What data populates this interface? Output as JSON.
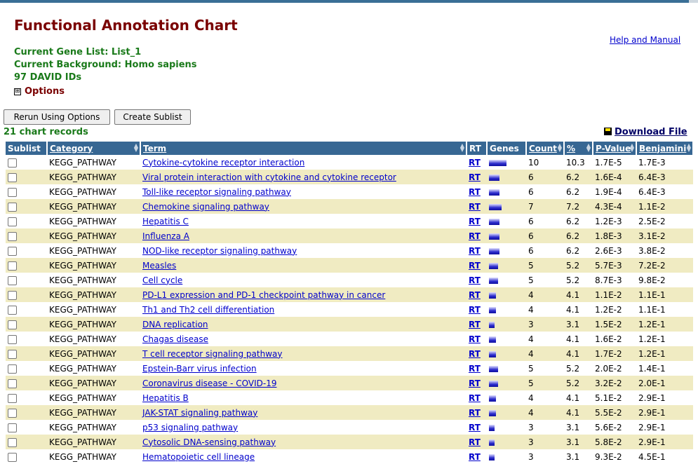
{
  "header": {
    "title": "Functional Annotation Chart",
    "help_link": "Help and Manual",
    "gene_list": "Current Gene List: List_1",
    "background": "Current Background: Homo sapiens",
    "id_count": "97 DAVID IDs",
    "options_toggle": "⊞",
    "options_label": "Options"
  },
  "toolbar": {
    "rerun_label": "Rerun Using Options",
    "sublist_label": "Create Sublist",
    "records_label": "21 chart records",
    "download_label": "Download File"
  },
  "table": {
    "columns": [
      "Sublist",
      "Category",
      "Term",
      "RT",
      "Genes",
      "Count",
      "%",
      "P-Value",
      "Benjamini"
    ],
    "rows": [
      {
        "category": "KEGG_PATHWAY",
        "term": "Cytokine-cytokine receptor interaction",
        "rt": "RT",
        "count": "10",
        "percent": "10.3",
        "pvalue": "1.7E-5",
        "benjamini": "1.7E-3"
      },
      {
        "category": "KEGG_PATHWAY",
        "term": "Viral protein interaction with cytokine and cytokine receptor",
        "rt": "RT",
        "count": "6",
        "percent": "6.2",
        "pvalue": "1.6E-4",
        "benjamini": "6.4E-3"
      },
      {
        "category": "KEGG_PATHWAY",
        "term": "Toll-like receptor signaling pathway",
        "rt": "RT",
        "count": "6",
        "percent": "6.2",
        "pvalue": "1.9E-4",
        "benjamini": "6.4E-3"
      },
      {
        "category": "KEGG_PATHWAY",
        "term": "Chemokine signaling pathway",
        "rt": "RT",
        "count": "7",
        "percent": "7.2",
        "pvalue": "4.3E-4",
        "benjamini": "1.1E-2"
      },
      {
        "category": "KEGG_PATHWAY",
        "term": "Hepatitis C",
        "rt": "RT",
        "count": "6",
        "percent": "6.2",
        "pvalue": "1.2E-3",
        "benjamini": "2.5E-2"
      },
      {
        "category": "KEGG_PATHWAY",
        "term": "Influenza A",
        "rt": "RT",
        "count": "6",
        "percent": "6.2",
        "pvalue": "1.8E-3",
        "benjamini": "3.1E-2"
      },
      {
        "category": "KEGG_PATHWAY",
        "term": "NOD-like receptor signaling pathway",
        "rt": "RT",
        "count": "6",
        "percent": "6.2",
        "pvalue": "2.6E-3",
        "benjamini": "3.8E-2"
      },
      {
        "category": "KEGG_PATHWAY",
        "term": "Measles",
        "rt": "RT",
        "count": "5",
        "percent": "5.2",
        "pvalue": "5.7E-3",
        "benjamini": "7.2E-2"
      },
      {
        "category": "KEGG_PATHWAY",
        "term": "Cell cycle",
        "rt": "RT",
        "count": "5",
        "percent": "5.2",
        "pvalue": "8.7E-3",
        "benjamini": "9.8E-2"
      },
      {
        "category": "KEGG_PATHWAY",
        "term": "PD-L1 expression and PD-1 checkpoint pathway in cancer",
        "rt": "RT",
        "count": "4",
        "percent": "4.1",
        "pvalue": "1.1E-2",
        "benjamini": "1.1E-1"
      },
      {
        "category": "KEGG_PATHWAY",
        "term": "Th1 and Th2 cell differentiation",
        "rt": "RT",
        "count": "4",
        "percent": "4.1",
        "pvalue": "1.2E-2",
        "benjamini": "1.1E-1"
      },
      {
        "category": "KEGG_PATHWAY",
        "term": "DNA replication",
        "rt": "RT",
        "count": "3",
        "percent": "3.1",
        "pvalue": "1.5E-2",
        "benjamini": "1.2E-1"
      },
      {
        "category": "KEGG_PATHWAY",
        "term": "Chagas disease",
        "rt": "RT",
        "count": "4",
        "percent": "4.1",
        "pvalue": "1.6E-2",
        "benjamini": "1.2E-1"
      },
      {
        "category": "KEGG_PATHWAY",
        "term": "T cell receptor signaling pathway",
        "rt": "RT",
        "count": "4",
        "percent": "4.1",
        "pvalue": "1.7E-2",
        "benjamini": "1.2E-1"
      },
      {
        "category": "KEGG_PATHWAY",
        "term": "Epstein-Barr virus infection",
        "rt": "RT",
        "count": "5",
        "percent": "5.2",
        "pvalue": "2.0E-2",
        "benjamini": "1.4E-1"
      },
      {
        "category": "KEGG_PATHWAY",
        "term": "Coronavirus disease - COVID-19",
        "rt": "RT",
        "count": "5",
        "percent": "5.2",
        "pvalue": "3.2E-2",
        "benjamini": "2.0E-1"
      },
      {
        "category": "KEGG_PATHWAY",
        "term": "Hepatitis B",
        "rt": "RT",
        "count": "4",
        "percent": "4.1",
        "pvalue": "5.1E-2",
        "benjamini": "2.9E-1"
      },
      {
        "category": "KEGG_PATHWAY",
        "term": "JAK-STAT signaling pathway",
        "rt": "RT",
        "count": "4",
        "percent": "4.1",
        "pvalue": "5.5E-2",
        "benjamini": "2.9E-1"
      },
      {
        "category": "KEGG_PATHWAY",
        "term": "p53 signaling pathway",
        "rt": "RT",
        "count": "3",
        "percent": "3.1",
        "pvalue": "5.6E-2",
        "benjamini": "2.9E-1"
      },
      {
        "category": "KEGG_PATHWAY",
        "term": "Cytosolic DNA-sensing pathway",
        "rt": "RT",
        "count": "3",
        "percent": "3.1",
        "pvalue": "5.8E-2",
        "benjamini": "2.9E-1"
      },
      {
        "category": "KEGG_PATHWAY",
        "term": "Hematopoietic cell lineage",
        "rt": "RT",
        "count": "3",
        "percent": "3.1",
        "pvalue": "9.3E-2",
        "benjamini": "4.5E-1"
      }
    ]
  },
  "colors": {
    "header_bg": "#376793",
    "title": "#7a0000",
    "info_green": "#1a7a1a",
    "row_alt": "#f0ebc2",
    "link": "#0000cc"
  }
}
